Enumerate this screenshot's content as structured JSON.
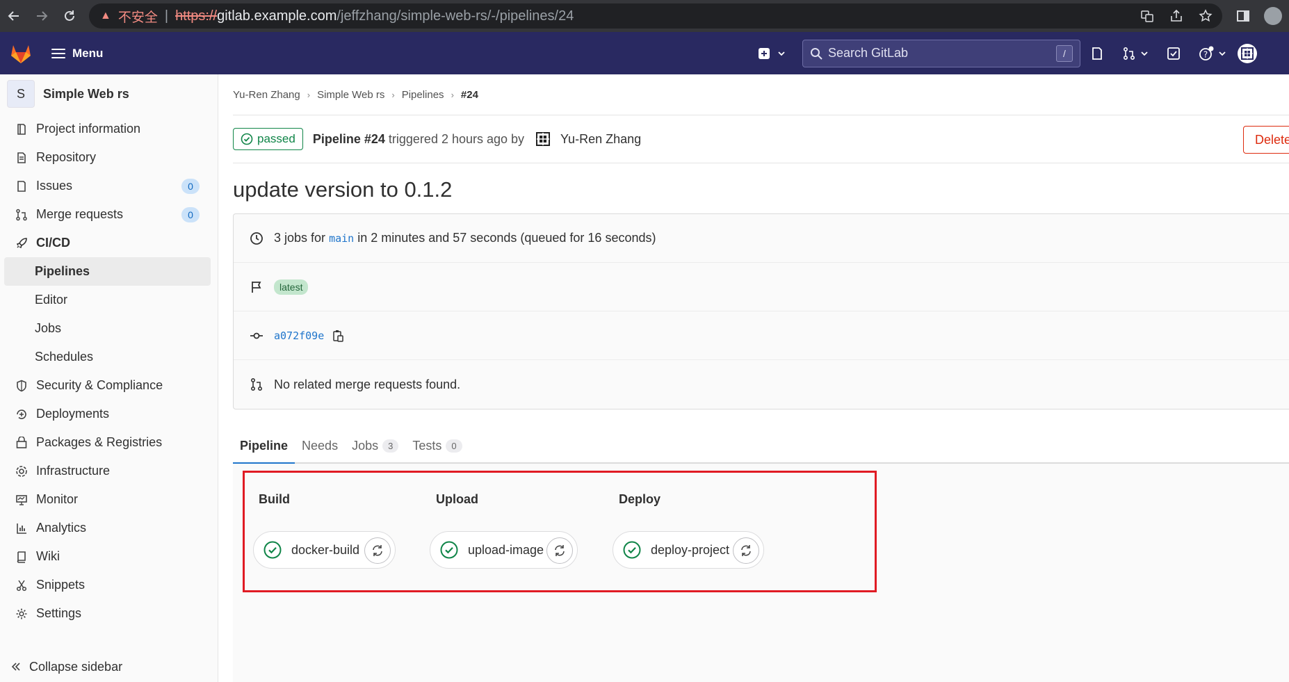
{
  "browser": {
    "insecure_label": "不安全",
    "url_scheme": "https://",
    "url_host": "gitlab.example.com",
    "url_path": "/jeffzhang/simple-web-rs/-/pipelines/24"
  },
  "header": {
    "menu_label": "Menu",
    "search_placeholder": "Search GitLab",
    "search_shortcut": "/"
  },
  "sidebar": {
    "project_initial": "S",
    "project_name": "Simple Web rs",
    "items": [
      {
        "label": "Project information",
        "icon": "info-icon"
      },
      {
        "label": "Repository",
        "icon": "doc-icon"
      },
      {
        "label": "Issues",
        "icon": "issues-icon",
        "count": "0"
      },
      {
        "label": "Merge requests",
        "icon": "merge-request-icon",
        "count": "0"
      },
      {
        "label": "CI/CD",
        "icon": "rocket-icon"
      },
      {
        "label": "Pipelines"
      },
      {
        "label": "Editor"
      },
      {
        "label": "Jobs"
      },
      {
        "label": "Schedules"
      },
      {
        "label": "Security & Compliance",
        "icon": "shield-icon"
      },
      {
        "label": "Deployments",
        "icon": "deployments-icon"
      },
      {
        "label": "Packages & Registries",
        "icon": "package-icon"
      },
      {
        "label": "Infrastructure",
        "icon": "cloud-gear-icon"
      },
      {
        "label": "Monitor",
        "icon": "monitor-icon"
      },
      {
        "label": "Analytics",
        "icon": "chart-icon"
      },
      {
        "label": "Wiki",
        "icon": "book-icon"
      },
      {
        "label": "Snippets",
        "icon": "scissors-icon"
      },
      {
        "label": "Settings",
        "icon": "gear-icon"
      }
    ],
    "collapse_label": "Collapse sidebar"
  },
  "breadcrumb": [
    "Yu-Ren Zhang",
    "Simple Web rs",
    "Pipelines",
    "#24"
  ],
  "pipeline": {
    "status": "passed",
    "name": "Pipeline #24",
    "triggered_text": "triggered 2 hours ago by",
    "user": "Yu-Ren Zhang",
    "delete_label": "Delete",
    "title": "update version to 0.1.2",
    "jobs_prefix": "3 jobs for",
    "branch": "main",
    "jobs_suffix": "in 2 minutes and 57 seconds (queued for 16 seconds)",
    "tag": "latest",
    "commit": "a072f09e",
    "mr_text": "No related merge requests found."
  },
  "tabs": [
    {
      "label": "Pipeline"
    },
    {
      "label": "Needs"
    },
    {
      "label": "Jobs",
      "count": "3"
    },
    {
      "label": "Tests",
      "count": "0"
    }
  ],
  "stages": [
    {
      "name": "Build",
      "job": "docker-build",
      "status": "success"
    },
    {
      "name": "Upload",
      "job": "upload-image",
      "status": "success"
    },
    {
      "name": "Deploy",
      "job": "deploy-project",
      "status": "success"
    }
  ],
  "colors": {
    "header_bg": "#292961",
    "success": "#108548",
    "link": "#1f75cb",
    "danger": "#dd2b0e",
    "highlight": "#e01b24"
  }
}
